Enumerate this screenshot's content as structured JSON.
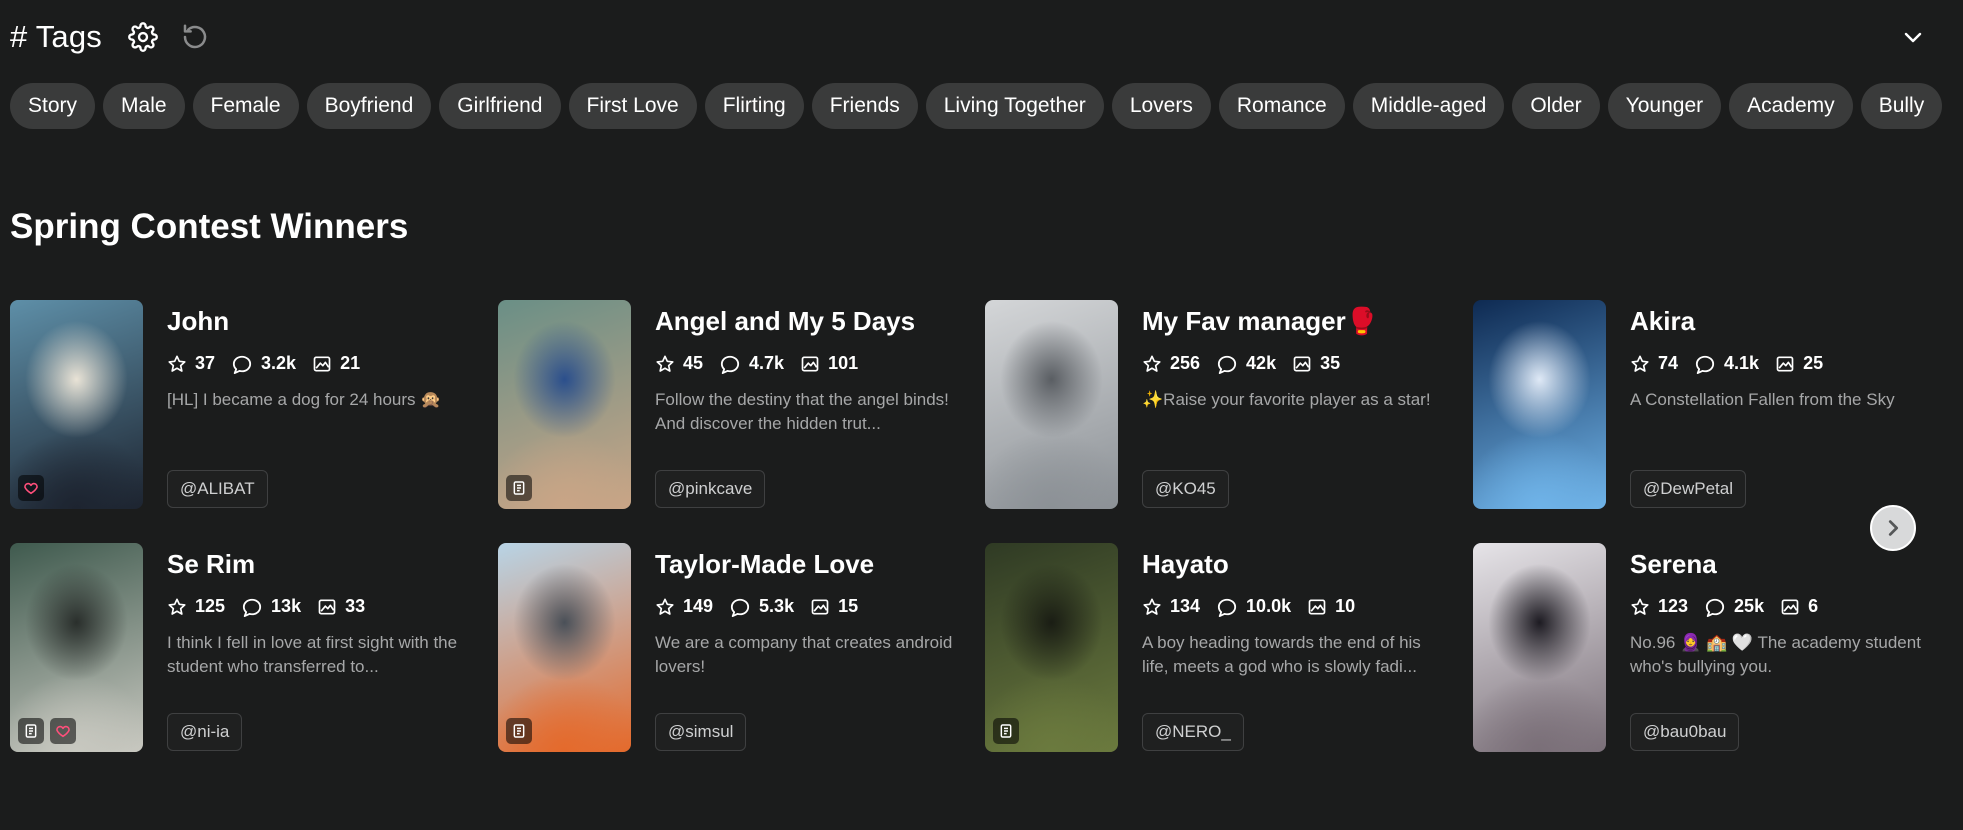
{
  "header": {
    "title": "# Tags"
  },
  "tags": [
    "Story",
    "Male",
    "Female",
    "Boyfriend",
    "Girlfriend",
    "First Love",
    "Flirting",
    "Friends",
    "Living Together",
    "Lovers",
    "Romance",
    "Middle-aged",
    "Older",
    "Younger",
    "Academy",
    "Bully"
  ],
  "section": {
    "title": "Spring Contest Winners"
  },
  "cards": [
    {
      "title": "John",
      "stars": "37",
      "chats": "3.2k",
      "images": "21",
      "desc": "[HL] I became a dog for 24 hours 🙊",
      "author": "@ALIBAT"
    },
    {
      "title": "Angel and My 5 Days",
      "stars": "45",
      "chats": "4.7k",
      "images": "101",
      "desc": "Follow the destiny that the angel binds! And discover the hidden trut...",
      "author": "@pinkcave"
    },
    {
      "title": "My Fav manager🥊",
      "stars": "256",
      "chats": "42k",
      "images": "35",
      "desc": "✨Raise your favorite player as a star!",
      "author": "@KO45"
    },
    {
      "title": "Akira",
      "stars": "74",
      "chats": "4.1k",
      "images": "25",
      "desc": "A Constellation Fallen from the Sky",
      "author": "@DewPetal"
    },
    {
      "title": "Se Rim",
      "stars": "125",
      "chats": "13k",
      "images": "33",
      "desc": "I think I fell in love at first sight with the student who transferred to...",
      "author": "@ni-ia"
    },
    {
      "title": "Taylor-Made Love",
      "stars": "149",
      "chats": "5.3k",
      "images": "15",
      "desc": "We are a company that creates android lovers!",
      "author": "@simsul"
    },
    {
      "title": "Hayato",
      "stars": "134",
      "chats": "10.0k",
      "images": "10",
      "desc": "A boy heading towards the end of his life, meets a god who is slowly fadi...",
      "author": "@NERO_"
    },
    {
      "title": "Serena",
      "stars": "123",
      "chats": "25k",
      "images": "6",
      "desc": "No.96 🧕 🏫 🤍 The academy student who's bullying you.",
      "author": "@bau0bau"
    }
  ],
  "thumb_colors": [
    [
      "#5e8fa8",
      "#1d2430",
      "#e9e3d6"
    ],
    [
      "#6a8f86",
      "#c9a586",
      "#2b4f8c"
    ],
    [
      "#d4d6d8",
      "#8c9196",
      "#5a5e63"
    ],
    [
      "#0e2a52",
      "#6fb3e8",
      "#dfe9f6"
    ],
    [
      "#3f5a4e",
      "#c8c8c0",
      "#2a2f2c"
    ],
    [
      "#b8d4e6",
      "#e46a2c",
      "#4a5058"
    ],
    [
      "#2f3a24",
      "#6b7a3e",
      "#1a1d14"
    ],
    [
      "#e6e4e8",
      "#7a6f78",
      "#1d1b22"
    ]
  ],
  "colors": {
    "background": "#1b1c1c",
    "chip": "#3a3b3b",
    "heart": "#ff4f7b"
  }
}
